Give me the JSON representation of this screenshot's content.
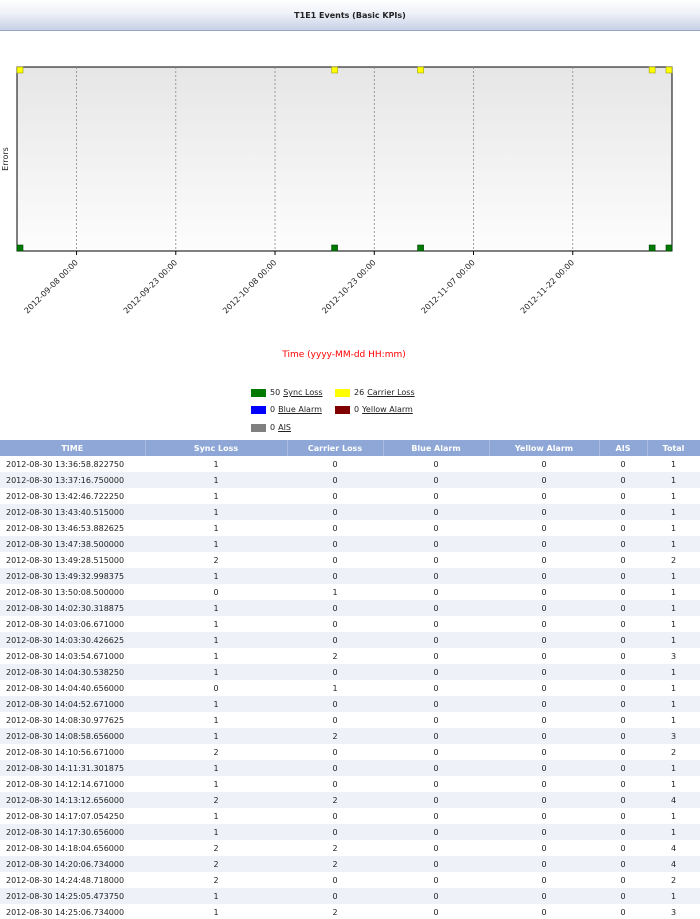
{
  "title": "T1E1 Events (Basic KPIs)",
  "chart_data": {
    "type": "scatter",
    "ylabel": "Errors",
    "xlabel": "Time (yyyy-MM-dd HH:mm)",
    "x_ticks": [
      "2012-09-08 00:00",
      "2012-09-23 00:00",
      "2012-10-08 00:00",
      "2012-10-23 00:00",
      "2012-11-07 00:00",
      "2012-11-22 00:00"
    ],
    "xlim": [
      "2012-08-30 00:00",
      "2012-12-07 00:00"
    ],
    "grid": "vertical dashed",
    "series": [
      {
        "name": "Sync Loss",
        "color": "#007a00",
        "level": "bottom",
        "x": [
          "2012-08-30 00:00",
          "2012-10-17 00:00",
          "2012-10-30 00:00",
          "2012-12-04 00:00",
          "2012-12-09 00:00"
        ]
      },
      {
        "name": "Carrier Loss",
        "color": "#ffff00",
        "level": "top",
        "x": [
          "2012-08-30 00:00",
          "2012-10-17 00:00",
          "2012-10-30 00:00",
          "2012-12-04 00:00",
          "2012-12-09 00:00"
        ]
      }
    ]
  },
  "legend": {
    "items": [
      {
        "count": "50",
        "name": "Sync Loss",
        "color": "#007a00"
      },
      {
        "count": "26",
        "name": "Carrier Loss",
        "color": "#ffff00"
      },
      {
        "count": "0",
        "name": "Blue Alarm",
        "color": "#0000ff"
      },
      {
        "count": "0",
        "name": "Yellow Alarm",
        "color": "#800000"
      },
      {
        "count": "0",
        "name": "AIS",
        "color": "#808080"
      }
    ]
  },
  "table": {
    "headers": [
      "TIME",
      "Sync Loss",
      "Carrier Loss",
      "Blue Alarm",
      "Yellow Alarm",
      "AIS",
      "Total"
    ],
    "rows": [
      [
        "2012-08-30 13:36:58.822750",
        "1",
        "0",
        "0",
        "0",
        "0",
        "1"
      ],
      [
        "2012-08-30 13:37:16.750000",
        "1",
        "0",
        "0",
        "0",
        "0",
        "1"
      ],
      [
        "2012-08-30 13:42:46.722250",
        "1",
        "0",
        "0",
        "0",
        "0",
        "1"
      ],
      [
        "2012-08-30 13:43:40.515000",
        "1",
        "0",
        "0",
        "0",
        "0",
        "1"
      ],
      [
        "2012-08-30 13:46:53.882625",
        "1",
        "0",
        "0",
        "0",
        "0",
        "1"
      ],
      [
        "2012-08-30 13:47:38.500000",
        "1",
        "0",
        "0",
        "0",
        "0",
        "1"
      ],
      [
        "2012-08-30 13:49:28.515000",
        "2",
        "0",
        "0",
        "0",
        "0",
        "2"
      ],
      [
        "2012-08-30 13:49:32.998375",
        "1",
        "0",
        "0",
        "0",
        "0",
        "1"
      ],
      [
        "2012-08-30 13:50:08.500000",
        "0",
        "1",
        "0",
        "0",
        "0",
        "1"
      ],
      [
        "2012-08-30 14:02:30.318875",
        "1",
        "0",
        "0",
        "0",
        "0",
        "1"
      ],
      [
        "2012-08-30 14:03:06.671000",
        "1",
        "0",
        "0",
        "0",
        "0",
        "1"
      ],
      [
        "2012-08-30 14:03:30.426625",
        "1",
        "0",
        "0",
        "0",
        "0",
        "1"
      ],
      [
        "2012-08-30 14:03:54.671000",
        "1",
        "2",
        "0",
        "0",
        "0",
        "3"
      ],
      [
        "2012-08-30 14:04:30.538250",
        "1",
        "0",
        "0",
        "0",
        "0",
        "1"
      ],
      [
        "2012-08-30 14:04:40.656000",
        "0",
        "1",
        "0",
        "0",
        "0",
        "1"
      ],
      [
        "2012-08-30 14:04:52.671000",
        "1",
        "0",
        "0",
        "0",
        "0",
        "1"
      ],
      [
        "2012-08-30 14:08:30.977625",
        "1",
        "0",
        "0",
        "0",
        "0",
        "1"
      ],
      [
        "2012-08-30 14:08:58.656000",
        "1",
        "2",
        "0",
        "0",
        "0",
        "3"
      ],
      [
        "2012-08-30 14:10:56.671000",
        "2",
        "0",
        "0",
        "0",
        "0",
        "2"
      ],
      [
        "2012-08-30 14:11:31.301875",
        "1",
        "0",
        "0",
        "0",
        "0",
        "1"
      ],
      [
        "2012-08-30 14:12:14.671000",
        "1",
        "0",
        "0",
        "0",
        "0",
        "1"
      ],
      [
        "2012-08-30 14:13:12.656000",
        "2",
        "2",
        "0",
        "0",
        "0",
        "4"
      ],
      [
        "2012-08-30 14:17:07.054250",
        "1",
        "0",
        "0",
        "0",
        "0",
        "1"
      ],
      [
        "2012-08-30 14:17:30.656000",
        "1",
        "0",
        "0",
        "0",
        "0",
        "1"
      ],
      [
        "2012-08-30 14:18:04.656000",
        "2",
        "2",
        "0",
        "0",
        "0",
        "4"
      ],
      [
        "2012-08-30 14:20:06.734000",
        "2",
        "2",
        "0",
        "0",
        "0",
        "4"
      ],
      [
        "2012-08-30 14:24:48.718000",
        "2",
        "0",
        "0",
        "0",
        "0",
        "2"
      ],
      [
        "2012-08-30 14:25:05.473750",
        "1",
        "0",
        "0",
        "0",
        "0",
        "1"
      ],
      [
        "2012-08-30 14:25:06.734000",
        "1",
        "2",
        "0",
        "0",
        "0",
        "3"
      ]
    ]
  }
}
